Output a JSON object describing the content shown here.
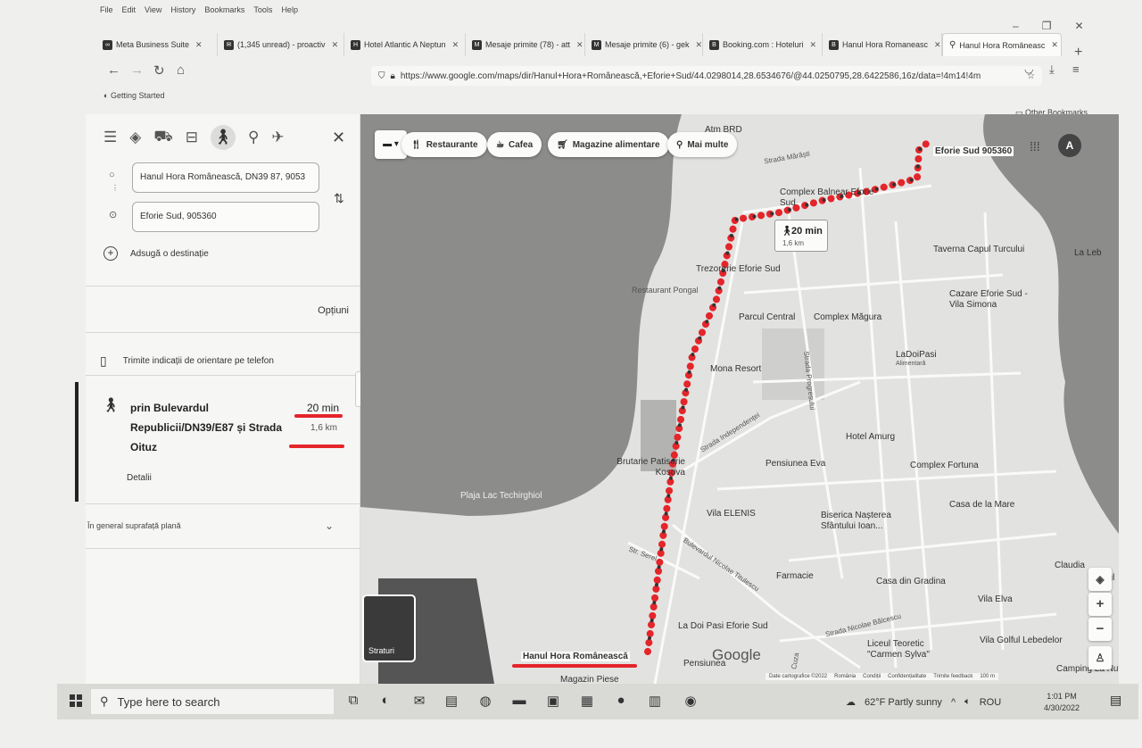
{
  "browser": {
    "menu": [
      "File",
      "Edit",
      "View",
      "History",
      "Bookmarks",
      "Tools",
      "Help"
    ],
    "tabs": [
      {
        "label": "Meta Business Suite",
        "icon": "meta-icon",
        "active": false
      },
      {
        "label": "(1,345 unread) - proactiv",
        "icon": "mail-icon",
        "active": false
      },
      {
        "label": "Hotel Atlantic A Neptun",
        "icon": "hotel-icon",
        "active": false
      },
      {
        "label": "Mesaje primite (78) - att",
        "icon": "gmail-icon",
        "active": false
      },
      {
        "label": "Mesaje primite (6) - gek",
        "icon": "gmail-icon",
        "active": false
      },
      {
        "label": "Booking.com : Hoteluri",
        "icon": "booking-icon",
        "active": false
      },
      {
        "label": "Hanul Hora Romaneasc",
        "icon": "booking-icon",
        "active": false
      },
      {
        "label": "Hanul Hora Româneasc",
        "icon": "maps-pin-icon",
        "active": true
      }
    ],
    "url": "https://www.google.com/maps/dir/Hanul+Hora+Românească,+Eforie+Sud/44.0298014,28.6534676/@44.0250795,28.6422586,16z/data=!4m14!4m",
    "bookmark": "Getting Started",
    "other_bookmarks": "Other Bookmarks"
  },
  "directions": {
    "origin": "Hanul Hora Românească, DN39 87, 9053",
    "destination": "Eforie Sud, 905360",
    "add_destination": "Adsugă o destinație",
    "options": "Opțiuni",
    "send_to_phone": "Trimite indicații de orientare pe telefon",
    "route": {
      "via": "prin Bulevardul Republicii/DN39/E87 și Strada Oituz",
      "time": "20 min",
      "distance": "1,6 km",
      "details": "Detalii"
    },
    "flat_note": "În general suprafață plană"
  },
  "map": {
    "chips": [
      "Restaurante",
      "Cafea",
      "Magazine alimentare",
      "Mai multe"
    ],
    "duration_box": {
      "time": "20 min",
      "distance": "1,6 km"
    },
    "avatar_letter": "A",
    "layers_label": "Straturi",
    "labels": {
      "atm": "Atm BRD",
      "eforie_sud": "Eforie Sud 905360",
      "strada_marasti": "Strada Mărăști",
      "complex_balnear": "Complex Balnear Eforie Sud",
      "taverna": "Taverna Capul Turcului",
      "la_lebada": "La Leb",
      "trezorerie": "Trezorerie Eforie Sud",
      "restaurant_pongal": "Restaurant Pongal",
      "cazare": "Cazare Eforie Sud - Vila Simona",
      "parcul_central": "Parcul Central",
      "complex_magura": "Complex Măgura",
      "strada_progresului": "Strada Progresului",
      "ladoipasi": "LaDoiPasi",
      "ladoipasi_sub": "Alimentară",
      "mona_resort": "Mona Resort",
      "strada_independentei": "Strada Independenței",
      "hotel_amurg": "Hotel Amurg",
      "brutarie": "Brutarie Patiserie Kosova",
      "pensiunea_eva": "Pensiunea Eva",
      "complex_fortuna": "Complex Fortuna",
      "plaja": "Plaja Lac Techirghiol",
      "vila_elenis": "Vila ELENIS",
      "biserica": "Biserica Nașterea Sfântului Ioan...",
      "casa_de_la_mare": "Casa de la Mare",
      "str_serel": "Str. Serel",
      "bulevardul": "Bulevardul Nicolae Titulescu",
      "claudia": "Claudia",
      "farmacie": "Farmacie",
      "casa_din_gradina": "Casa din Gradina",
      "vila_elva": "Vila Elva",
      "la_doi_pasi": "La Doi Pasi Eforie Sud",
      "strada_balcescu": "Strada Nicolae Bălcescu",
      "liceul": "Liceul Teoretic \"Carmen Sylva\"",
      "vila_golful": "Vila Golful Lebedelor",
      "hanul": "Hanul Hora Românească",
      "pensiunea": "Pensiunea",
      "magazin": "Magazin Piese",
      "cuza": "Cuza",
      "camping": "Camping La Nufăr",
      "gul": "gul"
    },
    "google_logo": "Google",
    "attribution": [
      "Date cartografice ©2022",
      "România",
      "Condiții",
      "Confidențialitate",
      "Trimite feedback",
      "100 m"
    ]
  },
  "taskbar": {
    "search_placeholder": "Type here to search",
    "weather": "62°F Partly sunny",
    "lang": "ROU",
    "time": "1:01 PM",
    "date": "4/30/2022"
  }
}
